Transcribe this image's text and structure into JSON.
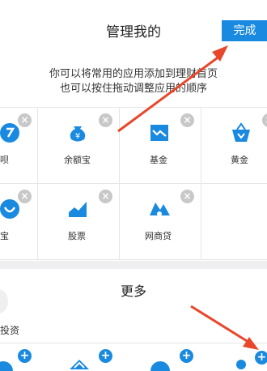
{
  "header": {
    "title": "管理我的",
    "done_label": "完成"
  },
  "hint": {
    "line1": "你可以将常用的应用添加到理财首页",
    "line2": "也可以按住拖动调整应用的顺序"
  },
  "my_apps": [
    {
      "label": "呗",
      "icon": "huabei-icon"
    },
    {
      "label": "余额宝",
      "icon": "yuebao-icon"
    },
    {
      "label": "基金",
      "icon": "fund-icon"
    },
    {
      "label": "黄金",
      "icon": "gold-icon"
    },
    {
      "label": "宝",
      "icon": "app-icon"
    },
    {
      "label": "股票",
      "icon": "stock-icon"
    },
    {
      "label": "网商贷",
      "icon": "loan-icon"
    }
  ],
  "remove_symbol": "×",
  "more": {
    "title": "更多",
    "partial_label": "投资",
    "add_symbol": "+"
  },
  "colors": {
    "accent": "#1a8ae0",
    "arrow": "#e8472b"
  }
}
